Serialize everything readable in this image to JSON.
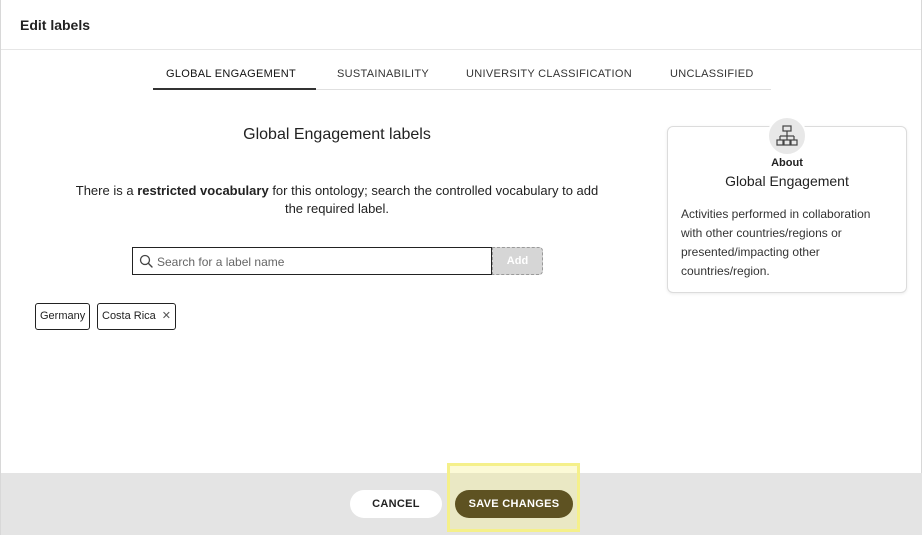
{
  "dialog": {
    "title": "Edit labels"
  },
  "tabs": [
    {
      "label": "GLOBAL ENGAGEMENT",
      "active": true
    },
    {
      "label": "SUSTAINABILITY",
      "active": false
    },
    {
      "label": "UNIVERSITY CLASSIFICATION",
      "active": false
    },
    {
      "label": "UNCLASSIFIED",
      "active": false
    }
  ],
  "main": {
    "section_title": "Global Engagement labels",
    "desc_prefix": "There is a ",
    "desc_bold": "restricted vocabulary",
    "desc_suffix": " for this ontology; search the controlled vocabulary to add the required label.",
    "search": {
      "placeholder": "Search for a label name",
      "value": "",
      "icon": "search-icon"
    },
    "add_label": "Add",
    "chips": [
      {
        "label": "Germany",
        "removable": false
      },
      {
        "label": "Costa Rica",
        "removable": true,
        "remove_glyph": "✕"
      }
    ]
  },
  "about": {
    "icon": "hierarchy-icon",
    "label": "About",
    "title": "Global Engagement",
    "text": "Activities performed in collaboration with other countries/regions or presented/impacting other countries/region."
  },
  "footer": {
    "cancel_label": "CANCEL",
    "save_label": "SAVE CHANGES"
  },
  "colors": {
    "save_button_bg": "#5e5222",
    "footer_bg": "#e4e4e4",
    "highlight": "#f5f08a"
  }
}
